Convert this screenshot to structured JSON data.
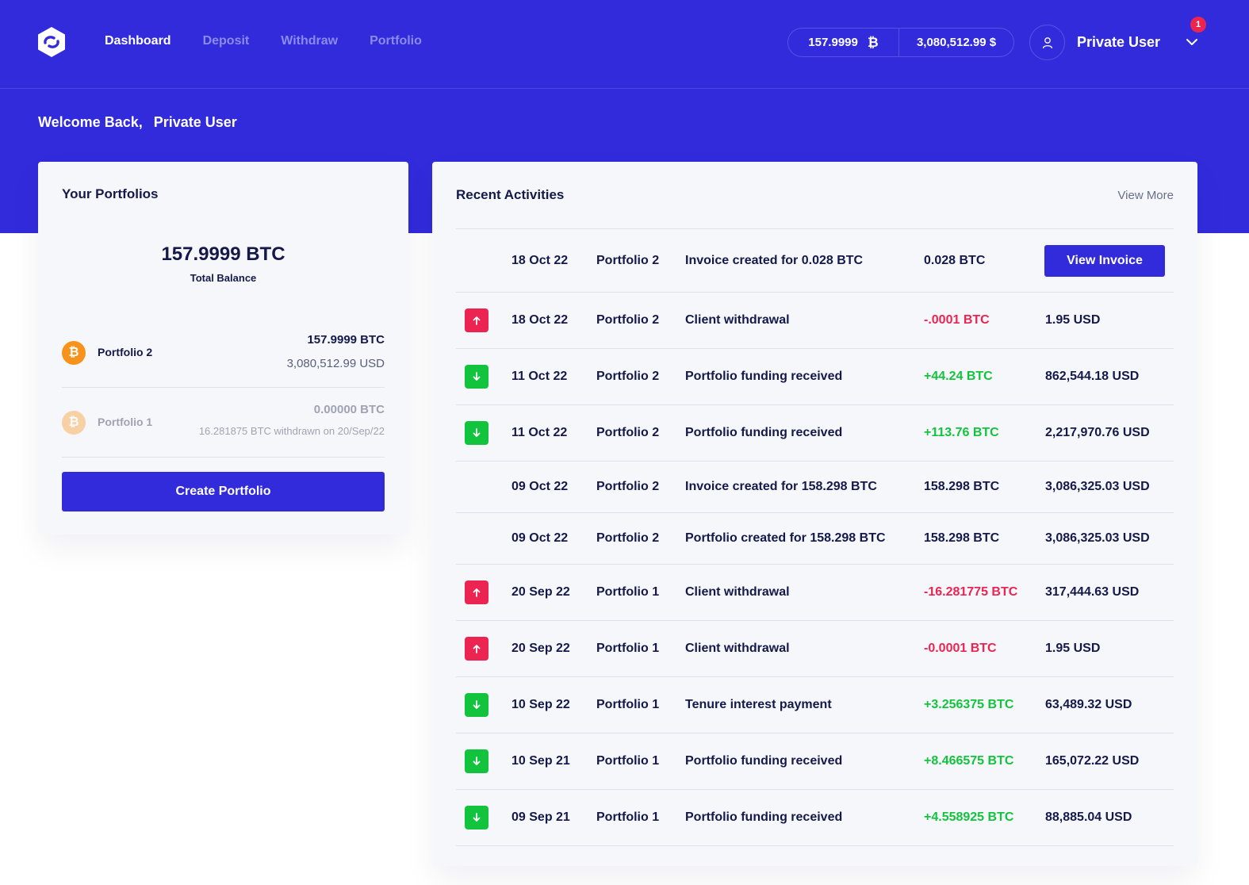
{
  "colors": {
    "brand": "#312bdc",
    "negative": "#ec2452",
    "positive": "#12c43d",
    "bitcoin": "#f7931a"
  },
  "header": {
    "logo_icon": "link-hexagon-icon",
    "nav": [
      {
        "label": "Dashboard",
        "active": true
      },
      {
        "label": "Deposit",
        "active": false
      },
      {
        "label": "Withdraw",
        "active": false
      },
      {
        "label": "Portfolio",
        "active": false
      }
    ],
    "balance_btc": "157.9999",
    "btc_symbol": "₿",
    "balance_usd": "3,080,512.99 $",
    "user_name": "Private User",
    "notification_count": "1"
  },
  "welcome": {
    "greeting": "Welcome Back,",
    "name": "Private User"
  },
  "portfolios": {
    "title": "Your Portfolios",
    "total_balance": "157.9999 BTC",
    "total_label": "Total Balance",
    "items": [
      {
        "name": "Portfolio 2",
        "btc": "157.9999 BTC",
        "usd": "3,080,512.99 USD",
        "active": true
      },
      {
        "name": "Portfolio 1",
        "btc": "0.00000 BTC",
        "note": "16.281875 BTC withdrawn on 20/Sep/22",
        "active": false
      }
    ],
    "create_label": "Create Portfolio"
  },
  "activities": {
    "title": "Recent Activities",
    "view_more": "View More",
    "invoice_button": "View Invoice",
    "rows": [
      {
        "icon": "none",
        "date": "18 Oct 22",
        "portfolio": "Portfolio 2",
        "desc": "Invoice created for 0.028 BTC",
        "amount": "0.028 BTC",
        "amount_type": "neutral",
        "usd": "",
        "action": "invoice"
      },
      {
        "icon": "up",
        "date": "18 Oct 22",
        "portfolio": "Portfolio 2",
        "desc": "Client withdrawal",
        "amount": "-.0001 BTC",
        "amount_type": "neg",
        "usd": "1.95 USD"
      },
      {
        "icon": "down",
        "date": "11 Oct 22",
        "portfolio": "Portfolio 2",
        "desc": "Portfolio funding received",
        "amount": "+44.24 BTC",
        "amount_type": "pos",
        "usd": "862,544.18 USD"
      },
      {
        "icon": "down",
        "date": "11 Oct 22",
        "portfolio": "Portfolio 2",
        "desc": "Portfolio funding received",
        "amount": "+113.76 BTC",
        "amount_type": "pos",
        "usd": "2,217,970.76 USD"
      },
      {
        "icon": "none",
        "date": "09 Oct 22",
        "portfolio": "Portfolio 2",
        "desc": "Invoice created for 158.298 BTC",
        "amount": "158.298 BTC",
        "amount_type": "neutral",
        "usd": "3,086,325.03 USD"
      },
      {
        "icon": "none",
        "date": "09 Oct 22",
        "portfolio": "Portfolio 2",
        "desc": "Portfolio created for 158.298 BTC",
        "amount": "158.298 BTC",
        "amount_type": "neutral",
        "usd": "3,086,325.03 USD"
      },
      {
        "icon": "up",
        "date": "20 Sep 22",
        "portfolio": "Portfolio 1",
        "desc": "Client withdrawal",
        "amount": "-16.281775 BTC",
        "amount_type": "neg",
        "usd": "317,444.63 USD"
      },
      {
        "icon": "up",
        "date": "20 Sep 22",
        "portfolio": "Portfolio 1",
        "desc": "Client withdrawal",
        "amount": "-0.0001 BTC",
        "amount_type": "neg",
        "usd": "1.95 USD"
      },
      {
        "icon": "down",
        "date": "10 Sep 22",
        "portfolio": "Portfolio 1",
        "desc": "Tenure interest payment",
        "amount": "+3.256375 BTC",
        "amount_type": "pos",
        "usd": "63,489.32 USD"
      },
      {
        "icon": "down",
        "date": "10 Sep 21",
        "portfolio": "Portfolio 1",
        "desc": "Portfolio funding received",
        "amount": "+8.466575 BTC",
        "amount_type": "pos",
        "usd": "165,072.22 USD"
      },
      {
        "icon": "down",
        "date": "09 Sep 21",
        "portfolio": "Portfolio 1",
        "desc": "Portfolio funding received",
        "amount": "+4.558925 BTC",
        "amount_type": "pos",
        "usd": "88,885.04 USD"
      }
    ]
  }
}
